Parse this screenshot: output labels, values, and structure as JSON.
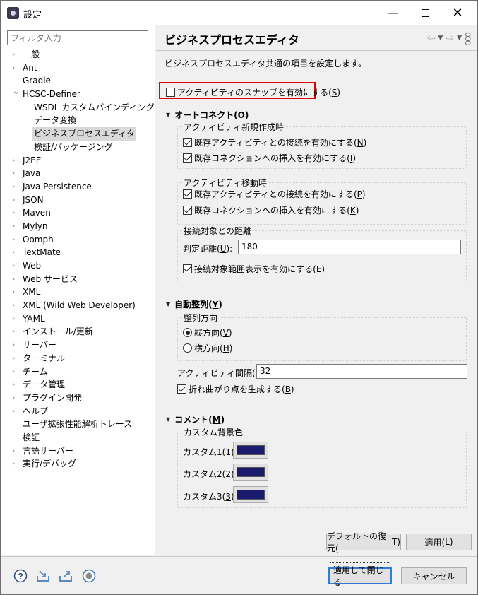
{
  "window": {
    "title": "設定",
    "controls": {
      "minimize": "—",
      "close": "✕"
    }
  },
  "sidebar": {
    "filter_placeholder": "フィルタ入力",
    "items": [
      {
        "label": "一般",
        "expandable": true,
        "level": 0
      },
      {
        "label": "Ant",
        "expandable": true,
        "level": 0
      },
      {
        "label": "Gradle",
        "expandable": false,
        "level": 0
      },
      {
        "label": "HCSC-Definer",
        "expandable": true,
        "expanded": true,
        "level": 0
      },
      {
        "label": "WSDL カスタムバインディング",
        "expandable": false,
        "level": 1
      },
      {
        "label": "データ変換",
        "expandable": false,
        "level": 1
      },
      {
        "label": "ビジネスプロセスエディタ",
        "expandable": false,
        "level": 1,
        "selected": true
      },
      {
        "label": "検証/パッケージング",
        "expandable": false,
        "level": 1
      },
      {
        "label": "J2EE",
        "expandable": true,
        "level": 0
      },
      {
        "label": "Java",
        "expandable": true,
        "level": 0
      },
      {
        "label": "Java Persistence",
        "expandable": true,
        "level": 0
      },
      {
        "label": "JSON",
        "expandable": true,
        "level": 0
      },
      {
        "label": "Maven",
        "expandable": true,
        "level": 0
      },
      {
        "label": "Mylyn",
        "expandable": true,
        "level": 0
      },
      {
        "label": "Oomph",
        "expandable": true,
        "level": 0
      },
      {
        "label": "TextMate",
        "expandable": true,
        "level": 0
      },
      {
        "label": "Web",
        "expandable": true,
        "level": 0
      },
      {
        "label": "Web サービス",
        "expandable": true,
        "level": 0
      },
      {
        "label": "XML",
        "expandable": true,
        "level": 0
      },
      {
        "label": "XML (Wild Web Developer)",
        "expandable": true,
        "level": 0
      },
      {
        "label": "YAML",
        "expandable": true,
        "level": 0
      },
      {
        "label": "インストール/更新",
        "expandable": true,
        "level": 0
      },
      {
        "label": "サーバー",
        "expandable": true,
        "level": 0
      },
      {
        "label": "ターミナル",
        "expandable": true,
        "level": 0
      },
      {
        "label": "チーム",
        "expandable": true,
        "level": 0
      },
      {
        "label": "データ管理",
        "expandable": true,
        "level": 0
      },
      {
        "label": "プラグイン開発",
        "expandable": true,
        "level": 0
      },
      {
        "label": "ヘルプ",
        "expandable": true,
        "level": 0
      },
      {
        "label": "ユーザ拡張性能解析トレース",
        "expandable": false,
        "level": 0
      },
      {
        "label": "検証",
        "expandable": false,
        "level": 0
      },
      {
        "label": "言語サーバー",
        "expandable": true,
        "level": 0
      },
      {
        "label": "実行/デバッグ",
        "expandable": true,
        "level": 0
      }
    ]
  },
  "page": {
    "title": "ビジネスプロセスエディタ",
    "description": "ビジネスプロセスエディタ共通の項目を設定します。",
    "snap": {
      "text": "アクティビティのスナップを有効にする(",
      "mnemonic": "S",
      "checked": false,
      "highlight_color": "#e00000"
    },
    "autoconnect": {
      "heading": "オートコネクト(",
      "mnemonic": "O",
      "new_group": {
        "label": "アクティビティ新規作成時",
        "connect": {
          "text": "既存アクティビティとの接続を有効にする(",
          "mnemonic": "N",
          "checked": true
        },
        "insert": {
          "text": "既存コネクションへの挿入を有効にする(",
          "mnemonic": "I",
          "checked": true
        }
      },
      "move_group": {
        "label": "アクティビティ移動時",
        "connect": {
          "text": "既存アクティビティとの接続を有効にする(",
          "mnemonic": "P",
          "checked": true
        },
        "insert": {
          "text": "既存コネクションへの挿入を有効にする(",
          "mnemonic": "K",
          "checked": true
        }
      },
      "distance_group": {
        "label": "接続対象との距離",
        "field_label": "判定距離(",
        "field_mnemonic": "U",
        "field_value": "180",
        "show_range": {
          "text": "接続対象範囲表示を有効にする(",
          "mnemonic": "E",
          "checked": true
        }
      }
    },
    "autoalign": {
      "heading": "自動整列(",
      "mnemonic": "Y",
      "direction_group": {
        "label": "整列方向",
        "vertical": {
          "text": "縦方向(",
          "mnemonic": "V",
          "checked": true
        },
        "horizontal": {
          "text": "横方向(",
          "mnemonic": "H",
          "checked": false
        }
      },
      "spacing_label": "アクティビティ間隔(",
      "spacing_mnemonic": "C",
      "spacing_value": "32",
      "bend": {
        "text": "折れ曲がり点を生成する(",
        "mnemonic": "B",
        "checked": true
      }
    },
    "comment": {
      "heading": "コメント(",
      "mnemonic": "M",
      "bg_group": {
        "label": "カスタム背景色",
        "colors": [
          {
            "label": "カスタム1(",
            "mnemonic": "1",
            "color": "#1a1a6e"
          },
          {
            "label": "カスタム2(",
            "mnemonic": "2",
            "color": "#1a1a6e"
          },
          {
            "label": "カスタム3(",
            "mnemonic": "3",
            "color": "#1a1a6e"
          }
        ]
      }
    },
    "buttons": {
      "restore_defaults": "デフォルトの復元(",
      "restore_mnemonic": "T",
      "apply": "適用(",
      "apply_mnemonic": "L"
    }
  },
  "footer": {
    "apply_close": "適用して閉じる",
    "cancel": "キャンセル",
    "icons": [
      "help-icon",
      "import-icon",
      "export-icon",
      "record-icon"
    ]
  }
}
